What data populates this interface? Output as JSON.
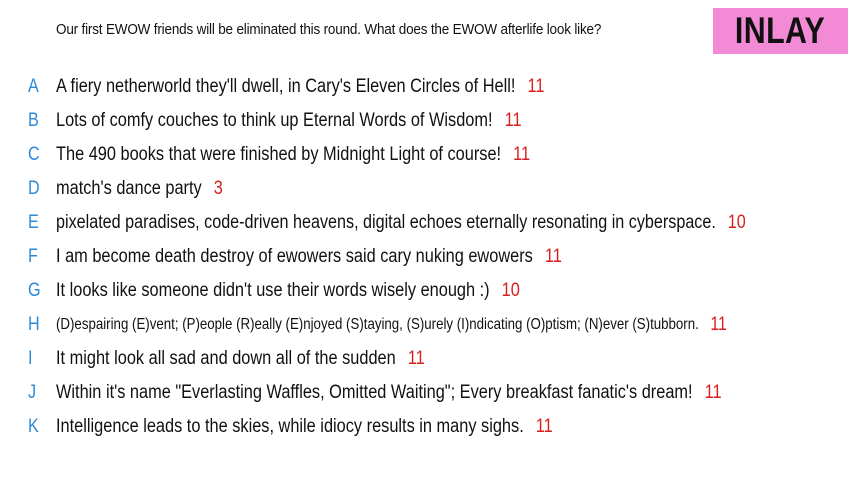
{
  "prompt": "Our first EWOW friends will be eliminated this round. What does the EWOW afterlife look like?",
  "badge": "INLAY",
  "entries": [
    {
      "letter": "A",
      "text": "A fiery netherworld they'll dwell, in Cary's Eleven Circles of Hell!",
      "count": "11"
    },
    {
      "letter": "B",
      "text": "Lots of comfy couches to think up Eternal Words of Wisdom!",
      "count": "11"
    },
    {
      "letter": "C",
      "text": "The 490 books that were finished by Midnight Light of course!",
      "count": "11"
    },
    {
      "letter": "D",
      "text": "match's dance party",
      "count": "3"
    },
    {
      "letter": "E",
      "text": "pixelated paradises, code-driven heavens, digital echoes eternally resonating in cyberspace.",
      "count": "10"
    },
    {
      "letter": "F",
      "text": "I am become death destroy of ewowers said cary nuking ewowers",
      "count": "11"
    },
    {
      "letter": "G",
      "text": "It looks like someone didn't use their words wisely enough :)",
      "count": "10"
    },
    {
      "letter": "H",
      "text": "(D)espairing (E)vent; (P)eople (R)eally (E)njoyed (S)taying, (S)urely (I)ndicating (O)ptism; (N)ever (S)tubborn.",
      "count": "11"
    },
    {
      "letter": "I",
      "text": "It might look all sad and down all of the sudden",
      "count": "11"
    },
    {
      "letter": "J",
      "text": "Within it's name \"Everlasting Waffles, Omitted Waiting\"; Every breakfast fanatic's dream!",
      "count": "11"
    },
    {
      "letter": "K",
      "text": "Intelligence leads to the skies, while idiocy results in many sighs.",
      "count": "11"
    }
  ]
}
